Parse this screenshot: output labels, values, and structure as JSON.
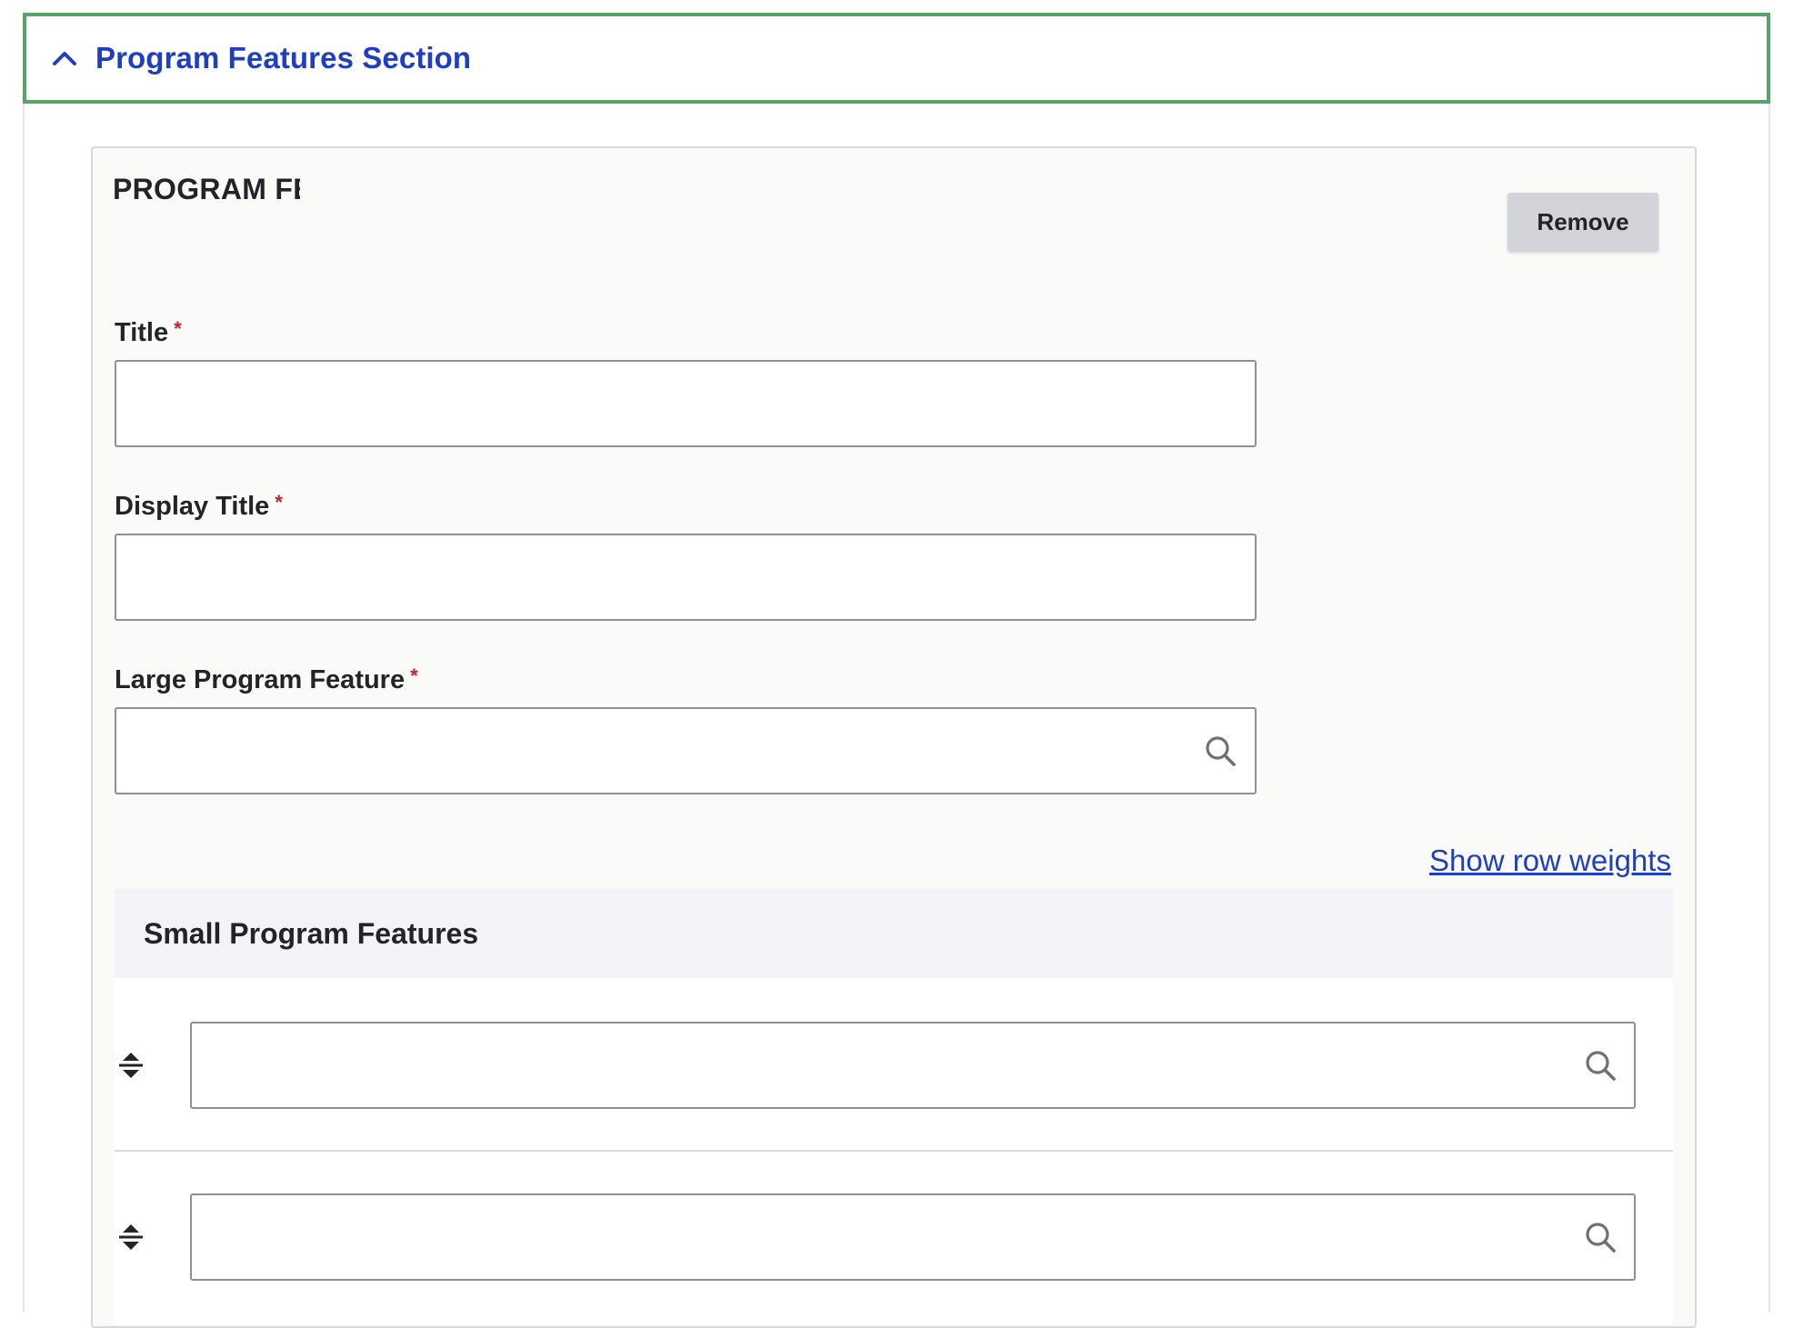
{
  "section": {
    "summary_title": "Program Features Section",
    "expanded": true
  },
  "paragraph": {
    "title": "PROGRAM FEATURES",
    "remove_label": "Remove"
  },
  "fields": {
    "title": {
      "label": "Title",
      "required_marker": "*",
      "value": ""
    },
    "display_title": {
      "label": "Display Title",
      "required_marker": "*",
      "value": ""
    },
    "large_feature": {
      "label": "Large Program Feature",
      "required_marker": "*",
      "value": ""
    }
  },
  "table": {
    "show_weights_label": "Show row weights",
    "header": "Small Program Features",
    "rows": [
      {
        "value": ""
      },
      {
        "value": ""
      }
    ]
  },
  "icons": {
    "summary": "chevron-up-icon",
    "search": "search-icon",
    "drag": "drag-handle-icon"
  },
  "colors": {
    "accent_blue": "#1f3fbf",
    "focus_green": "#55a469",
    "required_red": "#c3202e"
  }
}
